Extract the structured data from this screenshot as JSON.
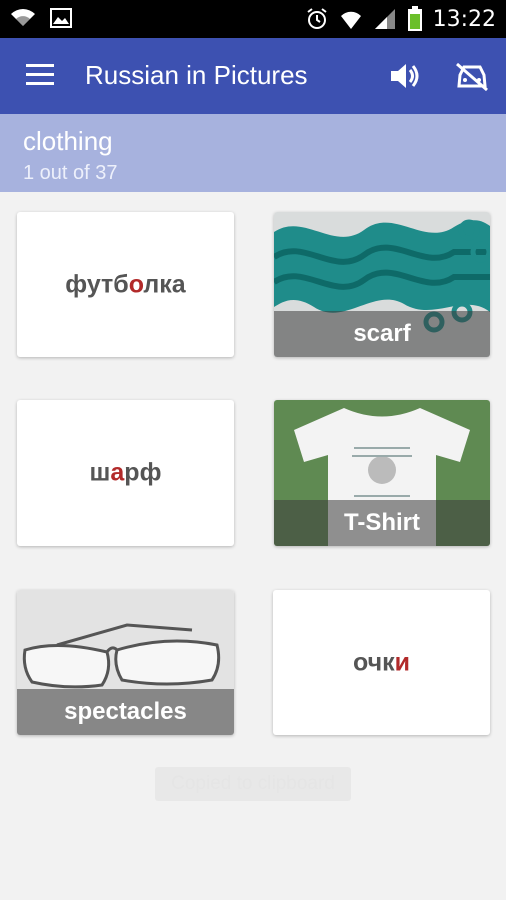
{
  "status_bar": {
    "time": "13:22"
  },
  "app_bar": {
    "title": "Russian in Pictures",
    "menu_icon": "hamburger-menu-icon",
    "speaker_icon": "speaker-icon",
    "car_icon": "car-off-icon"
  },
  "category": {
    "name": "clothing",
    "progress": "1 out of 37"
  },
  "cards": {
    "c1": {
      "word_pre": "футб",
      "word_stress": "о",
      "word_post": "лка"
    },
    "c2": {
      "caption": "scarf"
    },
    "c3": {
      "word_pre": "ш",
      "word_stress": "а",
      "word_post": "рф"
    },
    "c4": {
      "caption": "T-Shirt"
    },
    "c5": {
      "caption": "spectacles"
    },
    "c6": {
      "word_pre": "очк",
      "word_stress": "и",
      "word_post": ""
    }
  },
  "toast": "Copied to clipboard",
  "colors": {
    "app_bar": "#3d51b1",
    "sub_header": "#a7b2de",
    "stress": "#b22a2a"
  }
}
